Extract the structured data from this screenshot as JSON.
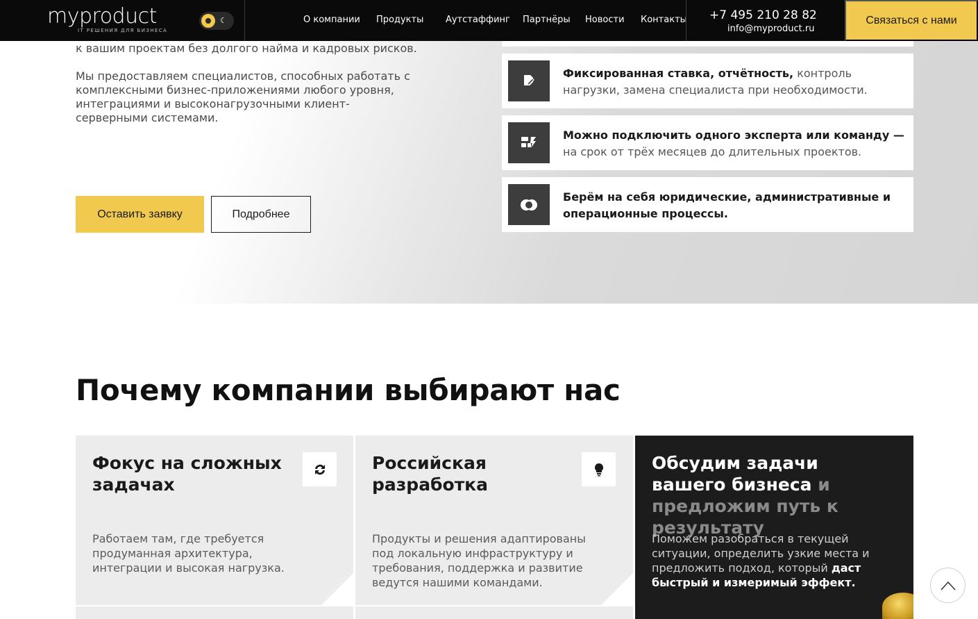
{
  "header": {
    "logo_text": "myproduct",
    "logo_tagline": "IT РЕШЕНИЯ ДЛЯ БИЗНЕСА",
    "nav": [
      "О компании",
      "Продукты",
      "Аутстаффинг",
      "Партнёры",
      "Новости",
      "Контакты"
    ],
    "phone": "+7 495 210 28 82",
    "email": "info@myproduct.ru",
    "cta_label": "Связаться с нами"
  },
  "hero": {
    "text_line": "к вашим проектам без долгого найма и кадровых рисков.",
    "paragraph": "Мы предоставляем специалистов, способных работать с комплексными бизнес-приложениями любого уровня, интеграциями и высоконагрузочными клиент-серверными системами.",
    "primary_button": "Оставить заявку",
    "secondary_button": "Подробнее",
    "features": [
      {
        "icon": "edit-document-icon",
        "bold": "Фиксированная ставка, отчётность,",
        "text": " контроль нагрузки, замена специалиста при необходимости."
      },
      {
        "icon": "team-icon",
        "bold": "Можно подключить одного эксперта или команду —",
        "text": " на срок от трёх месяцев до длительных проектов."
      },
      {
        "icon": "handshake-icon",
        "bold": "Берём на себя юридические, административные и операционные процессы.",
        "text": ""
      }
    ]
  },
  "why": {
    "title": "Почему компании выбирают нас",
    "cards": [
      {
        "title": "Фокус на сложных задачах",
        "text": "Работаем там, где требуется продуманная архитектура, интеграции и высокая нагрузка.",
        "icon": "refresh-arrows-icon"
      },
      {
        "title": "Российская разработка",
        "text": "Продукты и решения адаптированы под локальную инфраструктуру и требования, поддержка и развитие ведутся нашими командами.",
        "icon": "lightbulb-icon"
      }
    ],
    "dark_card": {
      "title_bold": "Обсудим задачи вашего бизнеса",
      "title_muted": " и предложим путь к результату",
      "text_plain": "Поможем разобраться в текущей ситуации, определить узкие места и предложить подход, который ",
      "text_bold": "даст быстрый и измеримый эффект."
    }
  },
  "colors": {
    "accent": "#f1c94f",
    "header_bg": "#0a0a0a",
    "dark_card": "#1c1c1c"
  }
}
